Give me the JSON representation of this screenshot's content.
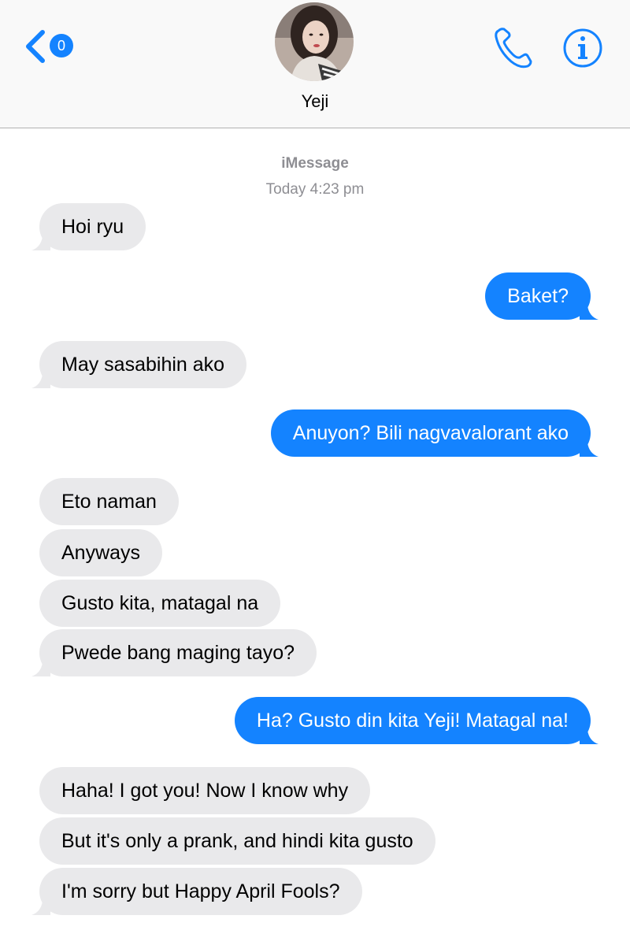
{
  "header": {
    "back_badge": "0",
    "contact_name": "Yeji"
  },
  "conversation": {
    "service": "iMessage",
    "timestamp": "Today 4:23 pm"
  },
  "messages": [
    {
      "from": "them",
      "text": "Hoi ryu"
    },
    {
      "from": "me",
      "text": "Baket?"
    },
    {
      "from": "them",
      "text": "May sasabihin ako"
    },
    {
      "from": "me",
      "text": "Anuyon? Bili nagvavalorant ako"
    },
    {
      "from": "them",
      "text": "Eto naman"
    },
    {
      "from": "them",
      "text": "Anyways"
    },
    {
      "from": "them",
      "text": "Gusto kita, matagal na"
    },
    {
      "from": "them",
      "text": "Pwede bang maging tayo?"
    },
    {
      "from": "me",
      "text": "Ha? Gusto din kita Yeji! Matagal na!"
    },
    {
      "from": "them",
      "text": "Haha! I got you! Now I know why"
    },
    {
      "from": "them",
      "text": "But it's only a prank, and hindi kita gusto"
    },
    {
      "from": "them",
      "text": "I'm sorry but Happy April Fools?"
    }
  ],
  "colors": {
    "accent": "#1483ff",
    "received_bubble": "#e9e9eb",
    "meta_text": "#8e8e93"
  }
}
